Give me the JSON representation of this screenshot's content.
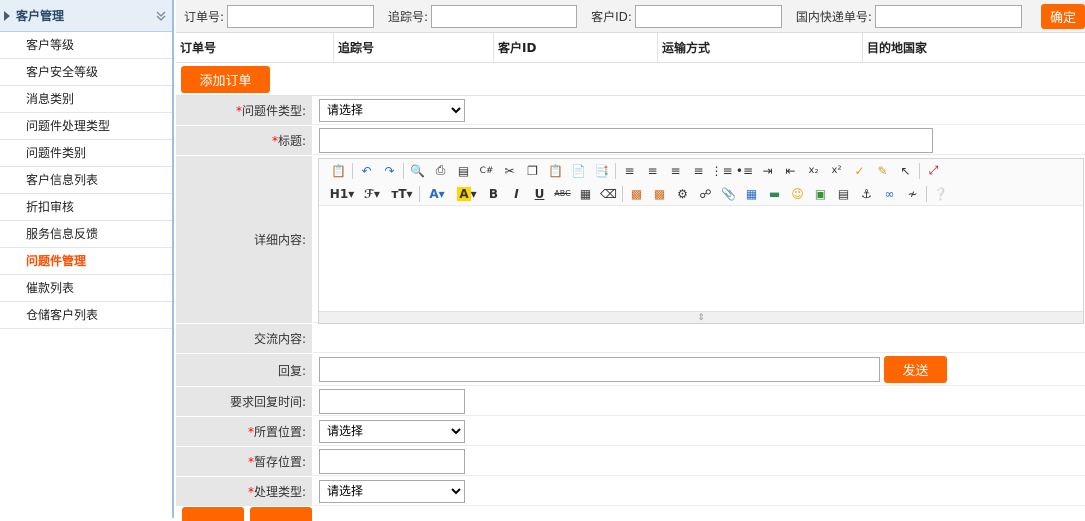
{
  "sidebar": {
    "title": "客户管理",
    "items": [
      {
        "label": "客户等级"
      },
      {
        "label": "客户安全等级"
      },
      {
        "label": "消息类别"
      },
      {
        "label": "问题件处理类型"
      },
      {
        "label": "问题件类别"
      },
      {
        "label": "客户信息列表"
      },
      {
        "label": "折扣审核"
      },
      {
        "label": "服务信息反馈"
      },
      {
        "label": "问题件管理",
        "active": true
      },
      {
        "label": "催款列表"
      },
      {
        "label": "仓储客户列表"
      }
    ]
  },
  "search": {
    "order_no_label": "订单号:",
    "order_no_value": "",
    "tracking_label": "追踪号:",
    "tracking_value": "",
    "customer_id_label": "客户ID:",
    "customer_id_value": "",
    "domestic_label": "国内快递单号:",
    "domestic_value": "",
    "confirm_label": "确定"
  },
  "table": {
    "headers": [
      "订单号",
      "追踪号",
      "客户ID",
      "运输方式",
      "目的地国家"
    ]
  },
  "add_order_label": "添加订单",
  "form": {
    "problem_type_label": "问题件类型:",
    "problem_type_value": "请选择",
    "title_label": "标题:",
    "title_value": "",
    "detail_label": "详细内容:",
    "exchange_label": "交流内容:",
    "reply_label": "回复:",
    "reply_value": "",
    "send_label": "发送",
    "reply_time_label": "要求回复时间:",
    "reply_time_value": "",
    "location_label": "所置位置:",
    "location_value": "请选择",
    "storage_label": "暂存位置:",
    "storage_value": "",
    "handle_type_label": "处理类型:",
    "handle_type_value": "请选择",
    "required_mark": "*"
  },
  "editor": {
    "toolbar_row1": [
      "source-icon",
      "undo-icon",
      "redo-icon",
      "preview-icon",
      "print-icon",
      "template-icon",
      "code-icon",
      "cut-icon",
      "copy-icon",
      "paste-icon",
      "paste-text-icon",
      "paste-word-icon",
      "align-left-icon",
      "align-center-icon",
      "align-right-icon",
      "justify-icon",
      "ordered-list-icon",
      "unordered-list-icon",
      "indent-icon",
      "outdent-icon",
      "subscript-icon",
      "superscript-icon",
      "clear-format-icon",
      "select-all-icon",
      "cursor-icon",
      "fullscreen-icon"
    ],
    "toolbar_row2_text": {
      "heading": "H1",
      "font_family": "ℱ",
      "font_size": "ᴛT",
      "bold": "B",
      "italic": "I",
      "underline": "U",
      "strike": "ABC"
    }
  },
  "colors": {
    "accent": "#ff6600",
    "active_nav": "#ff4e00",
    "label_bg": "#e6e6e6",
    "required": "#ff0000"
  }
}
